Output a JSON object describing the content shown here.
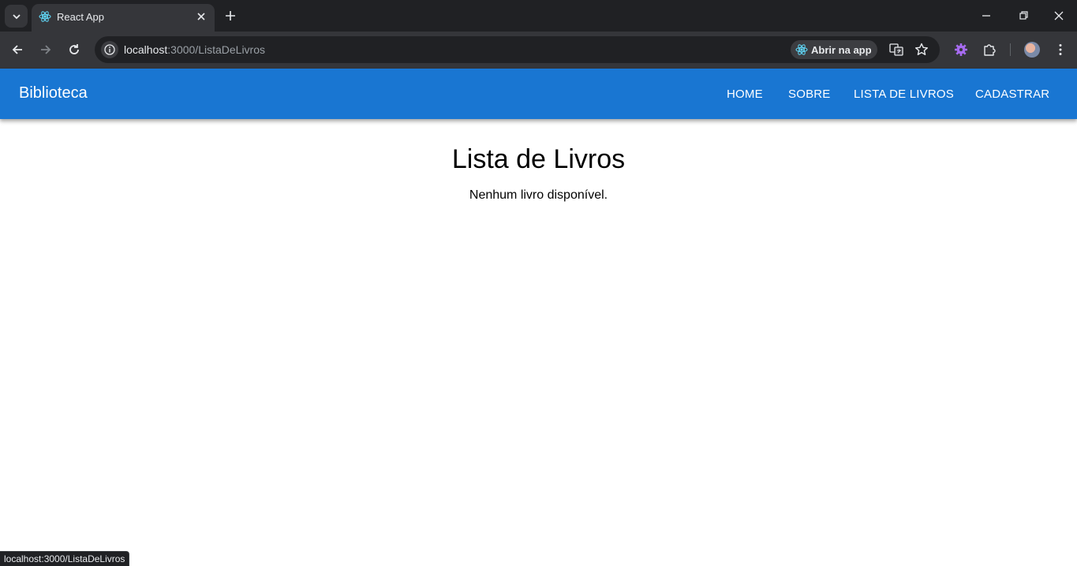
{
  "browser": {
    "tab": {
      "title": "React App",
      "favicon": "react-icon"
    },
    "url": {
      "host": "localhost",
      "rest": ":3000/ListaDeLivros"
    },
    "open_app_label": "Abrir na app",
    "status_url": "localhost:3000/ListaDeLivros"
  },
  "app": {
    "brand": "Biblioteca",
    "nav": [
      "HOME",
      "SOBRE",
      "LISTA DE LIVROS",
      "CADASTRAR"
    ],
    "accent_color": "#1976d2"
  },
  "main": {
    "title": "Lista de Livros",
    "empty_message": "Nenhum livro disponível."
  }
}
